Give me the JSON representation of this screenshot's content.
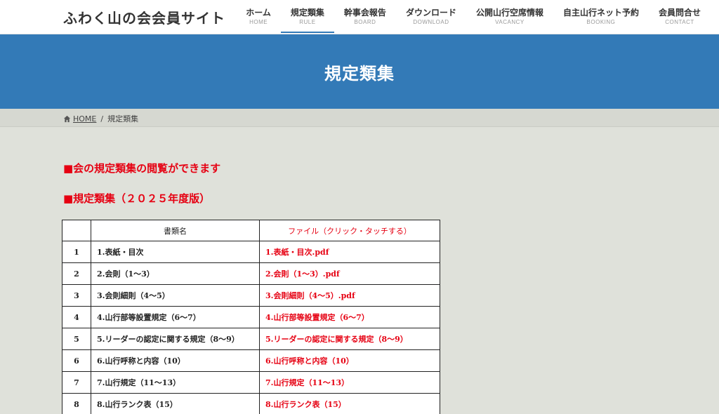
{
  "site": {
    "title": "ふわく山の会会員サイト"
  },
  "nav": [
    {
      "jp": "ホーム",
      "en": "HOME"
    },
    {
      "jp": "規定類集",
      "en": "RULE",
      "active": true
    },
    {
      "jp": "幹事会報告",
      "en": "BOARD"
    },
    {
      "jp": "ダウンロード",
      "en": "DOWNLOAD"
    },
    {
      "jp": "公開山行空席情報",
      "en": "VACANCY"
    },
    {
      "jp": "自主山行ネット予約",
      "en": "BOOKING"
    },
    {
      "jp": "会員問合せ",
      "en": "CONTACT"
    }
  ],
  "banner": {
    "title": "規定類集"
  },
  "breadcrumb": {
    "home": "HOME",
    "separator": "/",
    "current": "規定類集"
  },
  "content": {
    "heading1": "■会の規定類集の閲覧ができます",
    "heading2": "■規定類集（２０２５年度版）"
  },
  "table": {
    "headers": {
      "num": "",
      "name": "書類名",
      "file": "ファイル（クリック・タッチする）"
    },
    "rows": [
      {
        "num": "1",
        "name": "1.表紙・目次",
        "file": "1.表紙・目次.pdf"
      },
      {
        "num": "2",
        "name": "2.会則（1〜3）",
        "file": "2.会則（1〜3）.pdf"
      },
      {
        "num": "3",
        "name": "3.会則細則（4〜5）",
        "file": "3.会則細則（4〜5）.pdf"
      },
      {
        "num": "4",
        "name": "4.山行部等設置規定（6〜7）",
        "file": "4.山行部等設置規定（6〜7）"
      },
      {
        "num": "5",
        "name": "5.リーダーの認定に関する規定（8〜9）",
        "file": "5.リーダーの認定に関する規定（8〜9）"
      },
      {
        "num": "6",
        "name": "6.山行呼称と内容（10）",
        "file": "6.山行呼称と内容（10）"
      },
      {
        "num": "7",
        "name": "7.山行規定（11〜13）",
        "file": "7.山行規定（11〜13）"
      },
      {
        "num": "8",
        "name": "8.山行ランク表（15）",
        "file": "8.山行ランク表（15）"
      }
    ]
  },
  "colors": {
    "accent": "#337ab7",
    "heading_red": "#e60012",
    "background": "#dfe1da"
  },
  "icons": {
    "breadcrumb_home": "home-icon"
  }
}
